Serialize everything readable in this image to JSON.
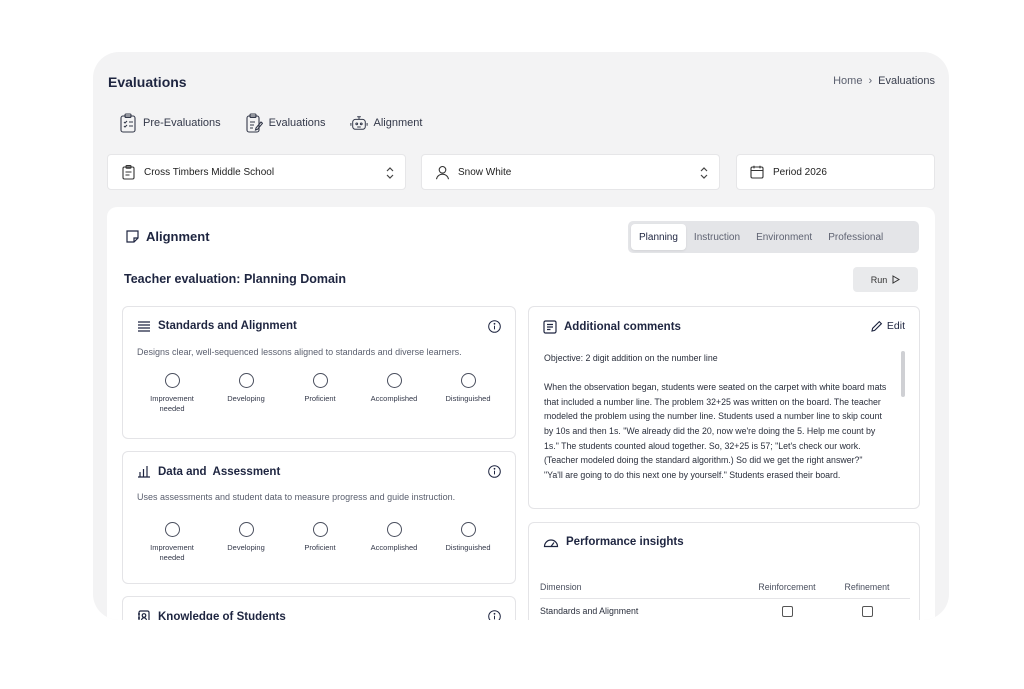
{
  "header": {
    "title": "Evaluations",
    "breadcrumb": [
      "Home",
      "Evaluations"
    ]
  },
  "top_nav": [
    {
      "label": "Pre-Evaluations",
      "icon": "clipboard-list-icon"
    },
    {
      "label": "Evaluations",
      "icon": "clipboard-edit-icon"
    },
    {
      "label": "Alignment",
      "icon": "robot-icon"
    }
  ],
  "filters": {
    "school": "Cross Timbers Middle School",
    "teacher": "Snow White",
    "period": "Period 2026"
  },
  "alignment_card": {
    "heading": "Alignment",
    "tabs": [
      "Planning",
      "Instruction",
      "Environment",
      "Professional"
    ],
    "active_tab": "Planning",
    "domain_title": "Teacher evaluation: Planning Domain",
    "run_label": "Run"
  },
  "rating_scale": [
    "Improvement needed",
    "Developing",
    "Proficient",
    "Accomplished",
    "Distinguished"
  ],
  "dimensions": [
    {
      "title": "Standards and Alignment",
      "desc": "Designs clear, well-sequenced lessons aligned to standards and diverse learners."
    },
    {
      "title": "Data and  Assessment",
      "desc": "Uses assessments and student data to measure progress and guide instruction."
    },
    {
      "title": "Knowledge of Students",
      "desc": ""
    }
  ],
  "comments": {
    "title": "Additional comments",
    "edit_label": "Edit",
    "objective": "Objective: 2 digit addition on the number line",
    "body": "When the observation began, students were seated on the carpet with white board mats that included a number line. The problem 32+25 was written on the board. The teacher modeled the problem using the number line. Students used a number line to skip count by 10s and then 1s. \"We already did the 20, now we're doing the 5. Help me count by 1s.\" The students counted aloud together. So, 32+25 is 57; \"Let's check our work. (Teacher modeled doing the standard algorithm.) So did we get the right answer?\"",
    "body2": "\"Ya'll are going to do this next one by yourself.\" Students erased their board."
  },
  "insights": {
    "title": "Performance insights",
    "columns": [
      "Dimension",
      "Reinforcement",
      "Refinement"
    ],
    "rows": [
      {
        "dimension": "Standards and Alignment"
      }
    ]
  }
}
